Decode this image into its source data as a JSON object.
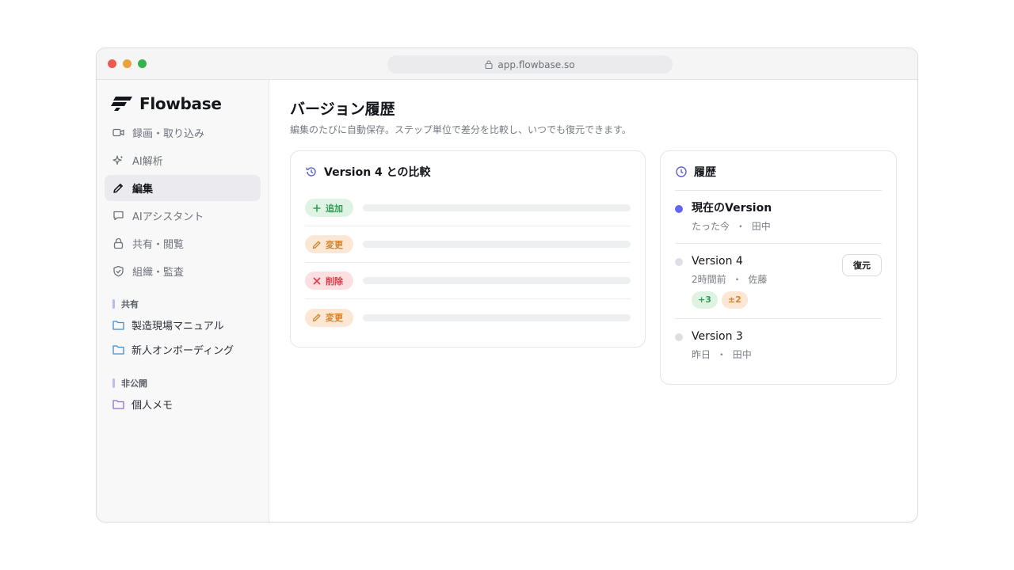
{
  "browser": {
    "url": "app.flowbase.so",
    "controls": {
      "close": "#ee5a52",
      "minimize": "#e9a23b",
      "zoom": "#37b24d"
    }
  },
  "sidebar": {
    "logo_text": "Flowbase",
    "nav": [
      {
        "label": "録画・取り込み",
        "icon": "video-icon"
      },
      {
        "label": "AI解析",
        "icon": "sparkle-icon"
      },
      {
        "label": "編集",
        "icon": "pencil-icon",
        "active": true
      },
      {
        "label": "AIアシスタント",
        "icon": "chat-icon"
      },
      {
        "label": "共有・閲覧",
        "icon": "lock-icon"
      },
      {
        "label": "組織・監査",
        "icon": "shield-icon"
      }
    ],
    "sections": [
      {
        "label": "共有",
        "folders": [
          "製造現場マニュアル",
          "新人オンボーディング"
        ]
      },
      {
        "label": "非公開",
        "folders": [
          "個人メモ"
        ]
      }
    ]
  },
  "main": {
    "title": "バージョン履歴",
    "subtitle": "編集のたびに自動保存。ステップ単位で差分を比較し、いつでも復元できます。",
    "compare": {
      "title": "Version 4 との比較",
      "rows": [
        {
          "type": "add",
          "label": "追加"
        },
        {
          "type": "change",
          "label": "変更"
        },
        {
          "type": "delete",
          "label": "削除"
        },
        {
          "type": "change",
          "label": "変更"
        }
      ]
    },
    "history": {
      "title": "履歴",
      "items": [
        {
          "name": "現在のVersion",
          "time": "たった今",
          "author": "田中",
          "current": true
        },
        {
          "name": "Version 4",
          "time": "2時間前",
          "author": "佐藤",
          "restore_label": "復元",
          "added": "+3",
          "modified": "±2"
        },
        {
          "name": "Version 3",
          "time": "昨日",
          "author": "田中"
        }
      ],
      "separator": "・"
    }
  },
  "colors": {
    "accent": "#6366f1",
    "add": "#2f9e53",
    "change": "#d5822d",
    "delete": "#db3b48"
  }
}
